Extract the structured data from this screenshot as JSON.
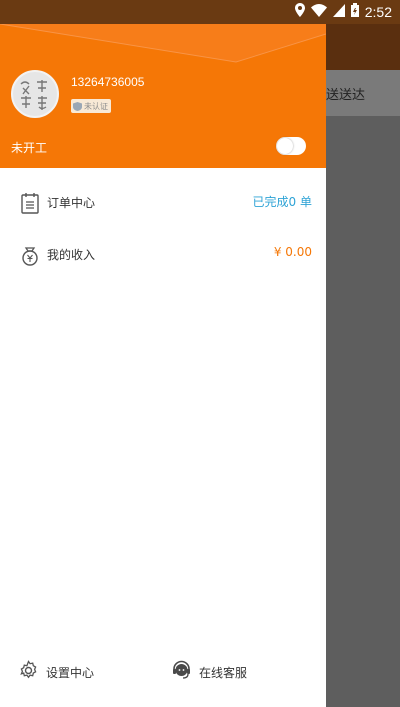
{
  "status_bar": {
    "time": "2:52",
    "icons": [
      "location-icon",
      "wifi-icon",
      "signal-icon",
      "battery-icon"
    ]
  },
  "background": {
    "tab_text": "送送达"
  },
  "drawer": {
    "header": {
      "phone": "13264736005",
      "badge": "未认证",
      "work_status": "未开工",
      "work_toggle_on": false,
      "accent_color": "#f57706"
    },
    "menu": [
      {
        "icon": "order-list-icon",
        "label": "订单中心",
        "value": "已完成0 单",
        "value_color": "#2ea3d6"
      },
      {
        "icon": "income-bag-icon",
        "label": "我的收入",
        "value": "¥ 0.00",
        "value_color": "#f57706"
      }
    ],
    "footer": [
      {
        "icon": "gear-icon",
        "label": "设置中心"
      },
      {
        "icon": "headset-icon",
        "label": "在线客服"
      }
    ]
  }
}
